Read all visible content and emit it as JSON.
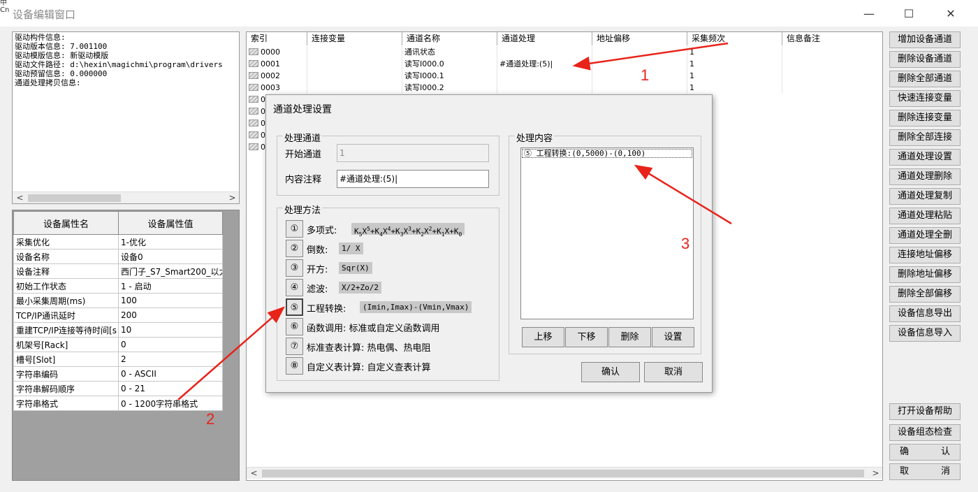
{
  "window": {
    "title": "设备编辑窗口",
    "corner_text": "中\nCn",
    "min_glyph": "—",
    "max_glyph": "☐",
    "close_glyph": "✕"
  },
  "info": {
    "lines": "驱动构件信息:\n驱动版本信息: 7.001100\n驱动模版信息: 新驱动模版\n驱动文件路径: d:\\hexin\\magichmi\\program\\drivers\n驱动预留信息: 0.000000\n通道处理拷贝信息:"
  },
  "props": {
    "header_name": "设备属性名",
    "header_value": "设备属性值",
    "rows": [
      {
        "name": "采集优化",
        "value": "1-优化"
      },
      {
        "name": "设备名称",
        "value": "设备0"
      },
      {
        "name": "设备注释",
        "value": "西门子_S7_Smart200_以太网"
      },
      {
        "name": "初始工作状态",
        "value": "1 - 启动"
      },
      {
        "name": "最小采集周期(ms)",
        "value": "100"
      },
      {
        "name": "TCP/IP通讯延时",
        "value": "200"
      },
      {
        "name": "重建TCP/IP连接等待时间[s",
        "value": "10"
      },
      {
        "name": "机架号[Rack]",
        "value": "0"
      },
      {
        "name": "槽号[Slot]",
        "value": "2"
      },
      {
        "name": "字符串编码",
        "value": "0 - ASCII"
      },
      {
        "name": "字符串解码顺序",
        "value": "0 - 21"
      },
      {
        "name": "字符串格式",
        "value": "0 - 1200字符串格式"
      }
    ]
  },
  "channels": {
    "headers": [
      "索引",
      "连接变量",
      "通道名称",
      "通道处理",
      "地址偏移",
      "采集频次",
      "信息备注"
    ],
    "rows": [
      {
        "index": "0000",
        "var": "",
        "name": "通讯状态",
        "proc": "",
        "offset": "",
        "freq": "1",
        "note": ""
      },
      {
        "index": "0001",
        "var": "",
        "name": "读写I000.0",
        "proc": "#通道处理:(5)|",
        "offset": "",
        "freq": "1",
        "note": ""
      },
      {
        "index": "0002",
        "var": "",
        "name": "读写I000.1",
        "proc": "",
        "offset": "",
        "freq": "1",
        "note": ""
      },
      {
        "index": "0003",
        "var": "",
        "name": "读写I000.2",
        "proc": "",
        "offset": "",
        "freq": "1",
        "note": ""
      }
    ],
    "hidden_row_stubs": [
      "0",
      "0",
      "0",
      "0",
      "0"
    ]
  },
  "right_buttons": [
    "增加设备通道",
    "删除设备通道",
    "删除全部通道",
    "快速连接变量",
    "删除连接变量",
    "删除全部连接",
    "通道处理设置",
    "通道处理删除",
    "通道处理复制",
    "通道处理粘贴",
    "通道处理全删",
    "连接地址偏移",
    "删除地址偏移",
    "删除全部偏移",
    "设备信息导出",
    "设备信息导入"
  ],
  "bottom_buttons": {
    "help": "打开设备帮助",
    "check": "设备组态检查",
    "ok_a": "确",
    "ok_b": "认",
    "cancel_a": "取",
    "cancel_b": "消"
  },
  "dialog": {
    "title": "通道处理设置",
    "group_channel": "处理通道",
    "start_label": "开始通道",
    "start_value": "1",
    "comment_label": "内容注释",
    "comment_value": "#通道处理:(5)|",
    "group_method": "处理方法",
    "methods": [
      {
        "num": "①",
        "label": "多项式:"
      },
      {
        "num": "②",
        "label": "倒数:",
        "formula": "1/ X"
      },
      {
        "num": "③",
        "label": "开方:",
        "formula": "Sqr(X)"
      },
      {
        "num": "④",
        "label": "滤波:",
        "formula": "X/2+Zo/2"
      },
      {
        "num": "⑤",
        "label": "工程转换:",
        "formula": "(Imin,Imax)-(Vmin,Vmax)"
      },
      {
        "num": "⑥",
        "label": "函数调用: 标准或自定义函数调用"
      },
      {
        "num": "⑦",
        "label": "标准查表计算: 热电偶、热电阻"
      },
      {
        "num": "⑧",
        "label": "自定义表计算: 自定义查表计算"
      }
    ],
    "group_content": "处理内容",
    "content_item": "⑤ 工程转换:(0,5000)-(0,100)",
    "btn_up": "上移",
    "btn_down": "下移",
    "btn_delete": "删除",
    "btn_settings": "设置",
    "btn_ok": "确认",
    "btn_cancel": "取消"
  },
  "annotations": {
    "label_1": "1",
    "label_2": "2",
    "label_3": "3",
    "arrow_color": "#e8231a"
  }
}
